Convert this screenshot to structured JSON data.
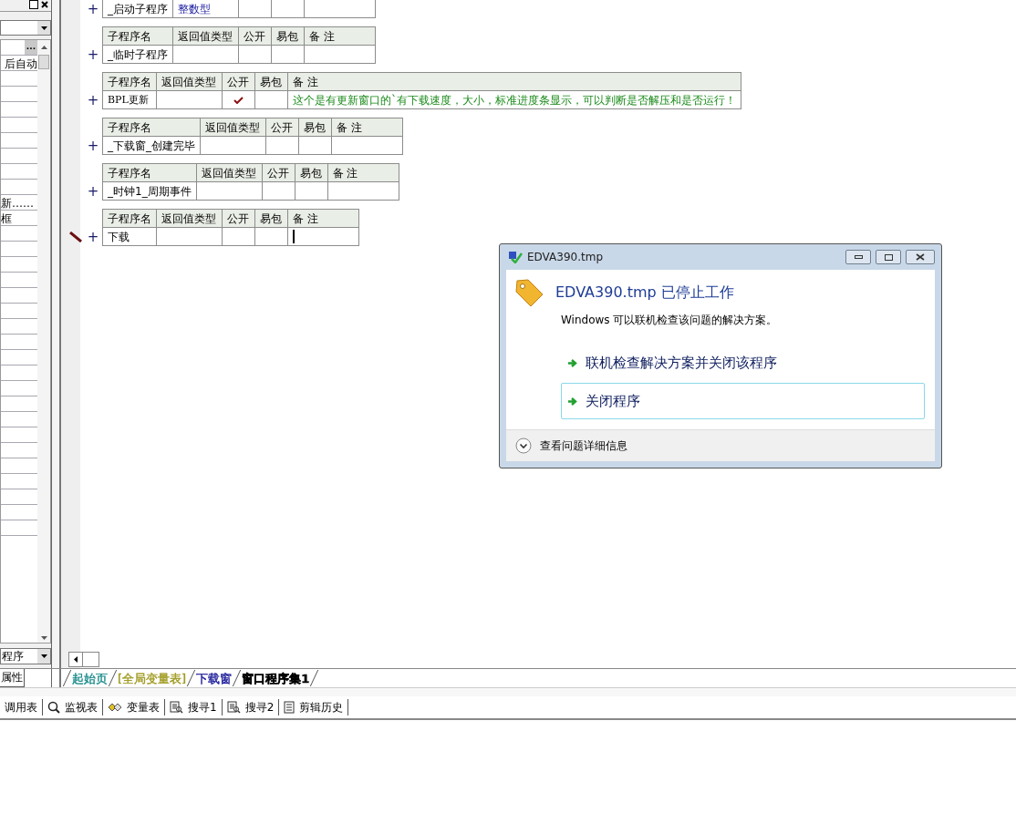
{
  "left_panel": {
    "property_rows": [
      {
        "text": "后自动"
      },
      {
        "text": "新……"
      },
      {
        "text": "框"
      }
    ],
    "bottom_combo": {
      "value": "程序"
    },
    "tab": {
      "label": "属性",
      "selected": true
    },
    "ellipsis": "..."
  },
  "procedures": [
    {
      "expander": "+",
      "name": "_启动子程序",
      "return_type": "整数型",
      "public": false,
      "editing": false
    },
    {
      "columns": [
        "子程序名",
        "返回值类型",
        "公开",
        "易包",
        "备 注"
      ],
      "expander": "+",
      "name": "_临时子程序",
      "public": false,
      "editing": false
    },
    {
      "columns": [
        "子程序名",
        "返回值类型",
        "公开",
        "易包",
        "备 注"
      ],
      "expander": "+",
      "name": "BPL更新",
      "public": true,
      "remark": "这个是有更新窗口的`有下载速度，大小，标准进度条显示，可以判断是否解压和是否运行！",
      "editing": false
    },
    {
      "columns": [
        "子程序名",
        "返回值类型",
        "公开",
        "易包",
        "备 注"
      ],
      "expander": "+",
      "name": "_下载窗_创建完毕",
      "public": false,
      "editing": false
    },
    {
      "columns": [
        "子程序名",
        "返回值类型",
        "公开",
        "易包",
        "备 注"
      ],
      "expander": "+",
      "name": "_时钟1_周期事件",
      "public": false,
      "editing": false
    },
    {
      "columns": [
        "子程序名",
        "返回值类型",
        "公开",
        "易包",
        "备 注"
      ],
      "expander": "+",
      "name": "下载",
      "public": false,
      "editing": true
    }
  ],
  "dialog": {
    "title": "EDVA390.tmp",
    "heading": "EDVA390.tmp 已停止工作",
    "message": "Windows 可以联机检查该问题的解决方案。",
    "options": [
      {
        "label": "联机检查解决方案并关闭该程序",
        "selected": false
      },
      {
        "label": "关闭程序",
        "selected": true
      }
    ],
    "details": "查看问题详细信息"
  },
  "tabs": [
    {
      "label": "起始页",
      "selected": false,
      "color": "#1a8a8a"
    },
    {
      "label": "[全局变量表]",
      "selected": false,
      "color": "#a09a20"
    },
    {
      "label": "下载窗",
      "selected": false,
      "color": "#1a1a9a"
    },
    {
      "label": "窗口程序集1",
      "selected": true,
      "color": "#000000"
    }
  ],
  "toolbar": [
    {
      "label": "调用表",
      "kind": "none"
    },
    {
      "label": "监视表",
      "kind": "search"
    },
    {
      "label": "变量表",
      "kind": "diamond"
    },
    {
      "label": "搜寻1",
      "kind": "find"
    },
    {
      "label": "搜寻2",
      "kind": "find"
    },
    {
      "label": "剪辑历史",
      "kind": "clip"
    }
  ]
}
